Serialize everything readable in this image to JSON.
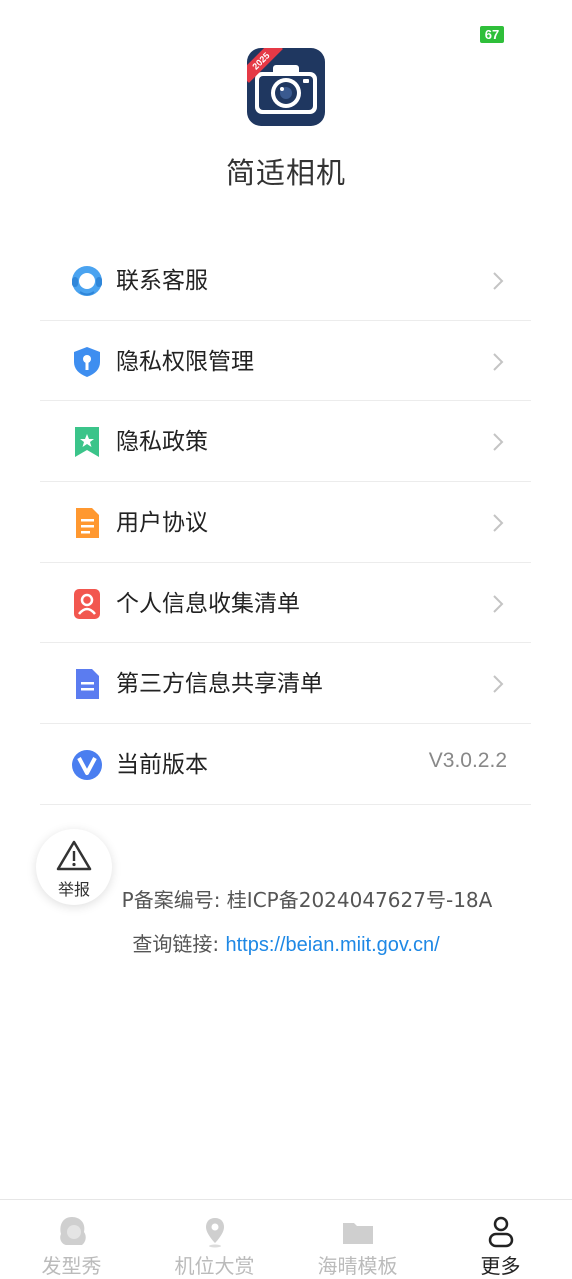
{
  "status_bar": {
    "battery": "67"
  },
  "app": {
    "name": "简适相机",
    "icon_badge": "2025"
  },
  "menu": {
    "items": [
      {
        "label": "联系客服",
        "icon": "headset-icon"
      },
      {
        "label": "隐私权限管理",
        "icon": "shield-key-icon"
      },
      {
        "label": "隐私政策",
        "icon": "bookmark-star-icon"
      },
      {
        "label": "用户协议",
        "icon": "document-icon"
      },
      {
        "label": "个人信息收集清单",
        "icon": "person-card-icon"
      },
      {
        "label": "第三方信息共享清单",
        "icon": "file-list-icon"
      }
    ],
    "version": {
      "label": "当前版本",
      "value": "V3.0.2.2",
      "icon": "v-badge-icon"
    }
  },
  "report": {
    "label": "举报"
  },
  "footer": {
    "icp_text": "P备案编号: 桂ICP备2024047627号-18A",
    "query_label": "查询链接: ",
    "query_link": "https://beian.miit.gov.cn/"
  },
  "tabbar": {
    "tabs": [
      {
        "label": "发型秀",
        "icon": "face-hair-icon",
        "active": false
      },
      {
        "label": "机位大赏",
        "icon": "location-pin-icon",
        "active": false
      },
      {
        "label": "海晴模板",
        "icon": "folder-icon",
        "active": false
      },
      {
        "label": "更多",
        "icon": "person-icon",
        "active": true
      }
    ]
  },
  "colors": {
    "accent_link": "#1e88e5",
    "battery": "#2fbf3a",
    "app_icon_bg": "#1f3760",
    "ribbon": "#e53946"
  }
}
